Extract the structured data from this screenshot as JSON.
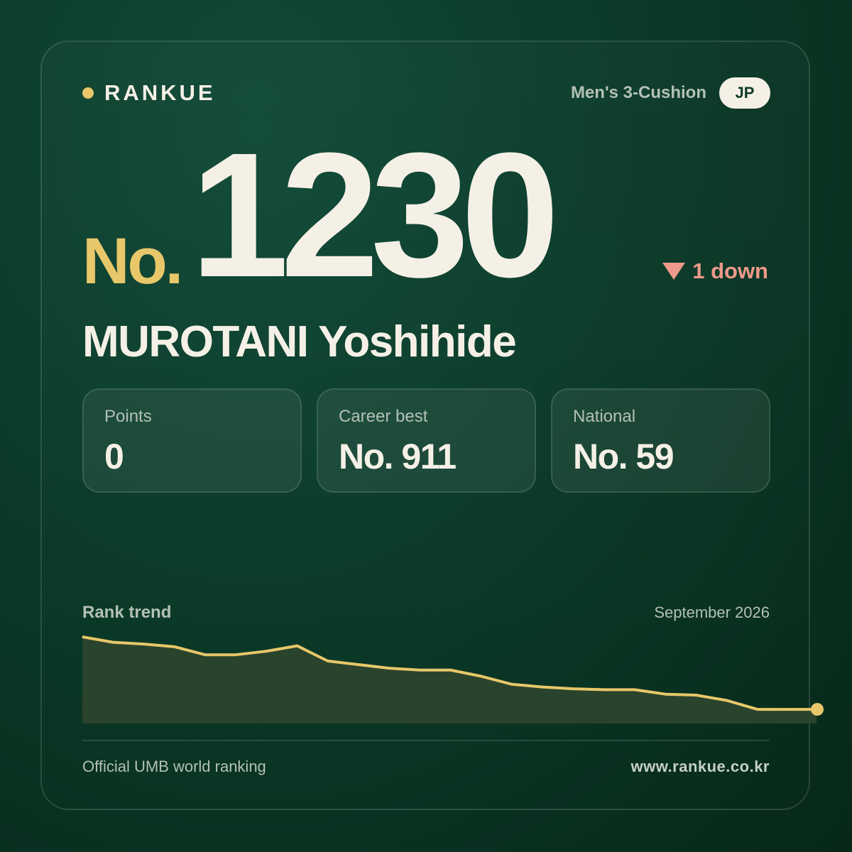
{
  "brand": {
    "name": "RANKUE"
  },
  "category": "Men's 3-Cushion",
  "country": "JP",
  "rank": {
    "prefix": "No.",
    "number": "1230",
    "change": "1 down"
  },
  "player": {
    "name": "MUROTANI Yoshihide"
  },
  "stats": [
    {
      "label": "Points",
      "value": "0"
    },
    {
      "label": "Career best",
      "value": "No. 911"
    },
    {
      "label": "National",
      "value": "No. 59"
    }
  ],
  "trend": {
    "title": "Rank trend",
    "date": "September 2026"
  },
  "footer": {
    "note": "Official UMB world ranking",
    "url": "www.rankue.co.kr"
  },
  "colors": {
    "accent": "#e7c76a",
    "down": "#ef9a8a",
    "text": "#f5f0e6",
    "muted": "#b3c0b6",
    "background": "#0b3a29"
  },
  "chart_data": {
    "type": "area",
    "title": "Rank trend",
    "x": [
      1,
      2,
      3,
      4,
      5,
      6,
      7,
      8,
      9,
      10,
      11,
      12,
      13,
      14,
      15,
      16,
      17,
      18,
      19,
      20,
      21,
      22,
      23,
      24
    ],
    "values": [
      0.92,
      0.86,
      0.84,
      0.81,
      0.72,
      0.72,
      0.76,
      0.82,
      0.65,
      0.61,
      0.57,
      0.55,
      0.55,
      0.48,
      0.39,
      0.36,
      0.34,
      0.33,
      0.33,
      0.28,
      0.27,
      0.21,
      0.11,
      0.11
    ],
    "value_note": "relative height of the rank line (higher = better rank)",
    "grid": false,
    "axes_labels_shown": false
  }
}
